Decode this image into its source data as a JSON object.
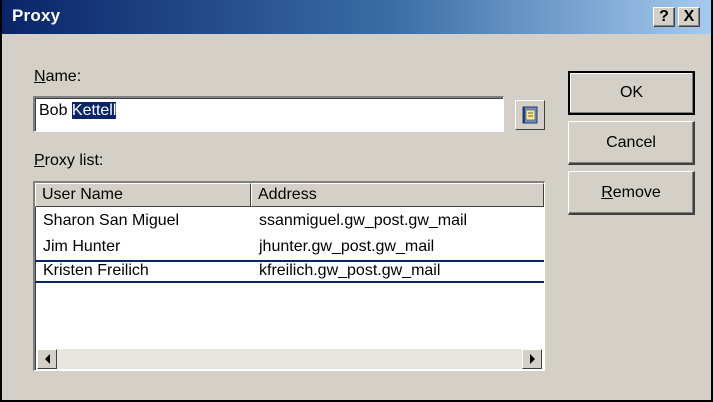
{
  "window": {
    "title": "Proxy",
    "help_button": "?",
    "close_button": "X"
  },
  "name_section": {
    "label_mnemonic": "N",
    "label_rest": "ame:",
    "value_prefix": "Bob ",
    "value_selected": "Kettell",
    "address_book_icon": "address-book-icon"
  },
  "proxy_list": {
    "label_mnemonic": "P",
    "label_rest": "roxy list:",
    "columns": [
      "User Name",
      "Address"
    ],
    "rows": [
      {
        "name": "Sharon San Miguel",
        "address": "ssanmiguel.gw_post.gw_mail"
      },
      {
        "name": "Jim Hunter",
        "address": "jhunter.gw_post.gw_mail"
      },
      {
        "name": "Kristen Freilich",
        "address": "kfreilich.gw_post.gw_mail"
      }
    ],
    "focused_row": 2
  },
  "buttons": {
    "ok": "OK",
    "cancel": "Cancel",
    "remove_mnemonic": "R",
    "remove_rest": "emove"
  },
  "colors": {
    "title_gradient_start": "#0a246a",
    "title_gradient_end": "#a6caf0",
    "dialog_face": "#d4d0c8",
    "selection": "#0a246a"
  }
}
